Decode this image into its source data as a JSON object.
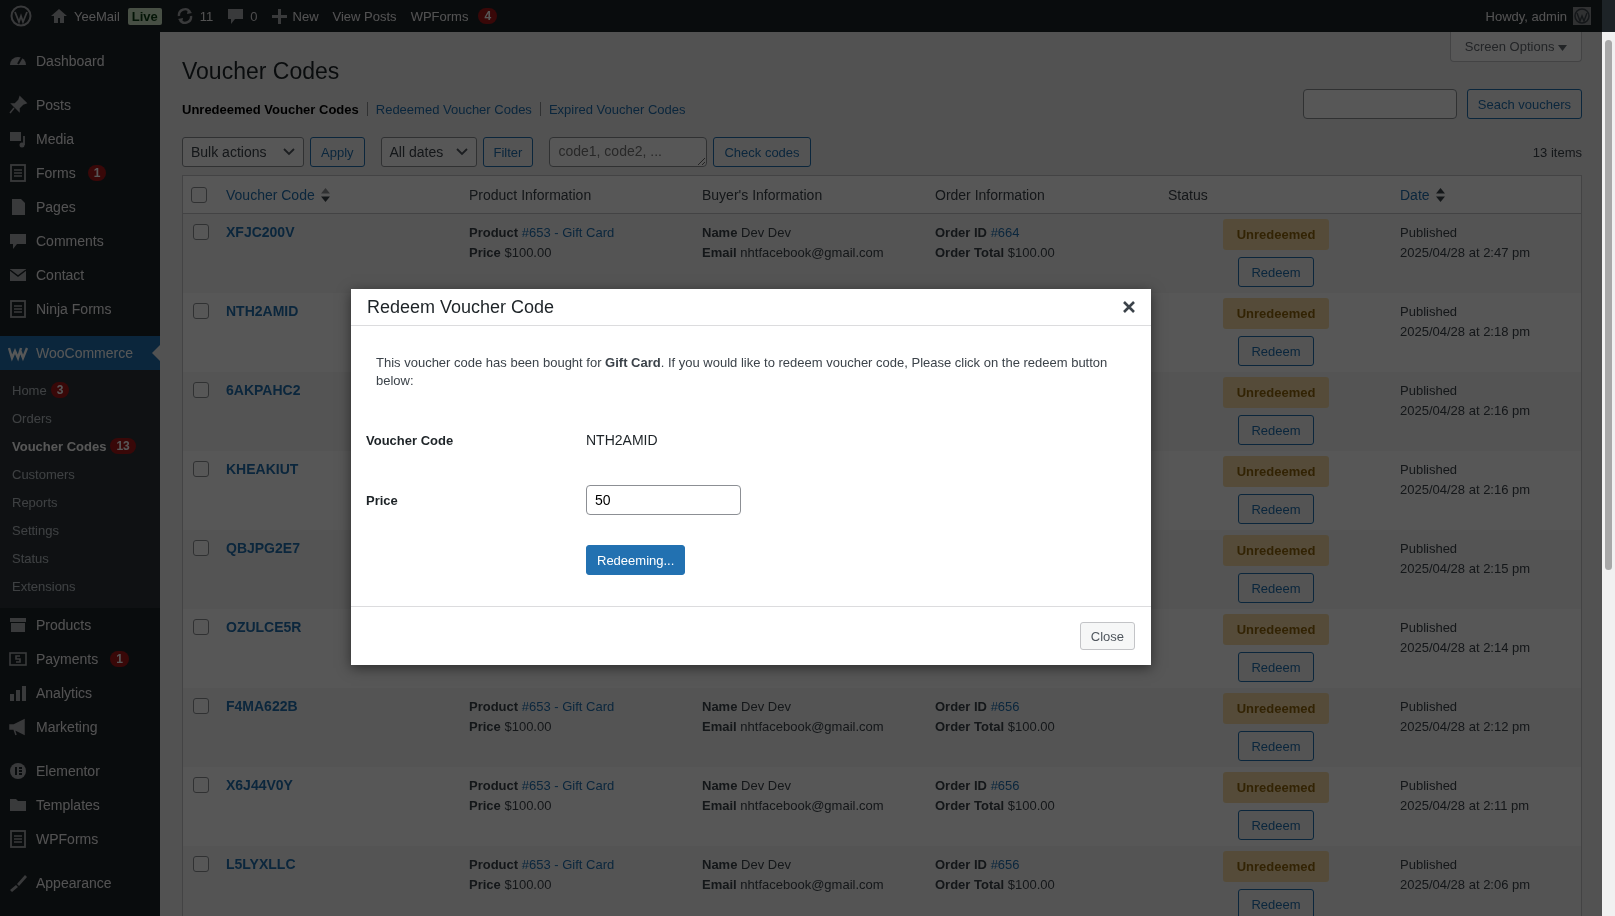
{
  "admin_bar": {
    "items": [
      {
        "kind": "logo"
      },
      {
        "kind": "site",
        "label": "YeeMail",
        "badge": "Live"
      },
      {
        "kind": "updates",
        "label": "11"
      },
      {
        "kind": "comments",
        "label": "0"
      },
      {
        "kind": "new",
        "label": "New"
      },
      {
        "kind": "link",
        "label": "View Posts"
      },
      {
        "kind": "link",
        "label": "WPForms",
        "count": "4"
      }
    ],
    "greeting": "Howdy, admin"
  },
  "sidebar": {
    "groups": [
      [
        {
          "label": "Dashboard",
          "selected": false
        }
      ],
      [
        {
          "label": "Posts",
          "selected": false
        },
        {
          "label": "Media",
          "selected": false
        },
        {
          "label": "Forms",
          "badge": "1",
          "selected": false
        },
        {
          "label": "Pages",
          "selected": false
        },
        {
          "label": "Comments",
          "selected": false
        },
        {
          "label": "Contact",
          "selected": false
        },
        {
          "label": "Ninja Forms",
          "selected": false
        }
      ],
      [
        {
          "label": "WooCommerce",
          "selected": true,
          "children": [
            {
              "label": "Home",
              "badge": "3",
              "selected": false
            },
            {
              "label": "Orders",
              "selected": false
            },
            {
              "label": "Voucher Codes",
              "badge": "13",
              "selected": true
            },
            {
              "label": "Customers",
              "selected": false
            },
            {
              "label": "Reports",
              "selected": false
            },
            {
              "label": "Settings",
              "selected": false
            },
            {
              "label": "Status",
              "selected": false
            },
            {
              "label": "Extensions",
              "selected": false
            }
          ]
        },
        {
          "label": "Products",
          "selected": false
        },
        {
          "label": "Payments",
          "badge": "1",
          "selected": false
        },
        {
          "label": "Analytics",
          "selected": false
        },
        {
          "label": "Marketing",
          "selected": false
        }
      ],
      [
        {
          "label": "Elementor",
          "selected": false
        },
        {
          "label": "Templates",
          "selected": false
        },
        {
          "label": "WPForms",
          "selected": false
        }
      ],
      [
        {
          "label": "Appearance",
          "selected": false
        }
      ]
    ]
  },
  "screen_options": "Screen Options",
  "page_title": "Voucher Codes",
  "views": [
    {
      "label": "Unredeemed Voucher Codes",
      "selected": true
    },
    {
      "label": "Redeemed Voucher Codes",
      "selected": false
    },
    {
      "label": "Expired Voucher Codes",
      "selected": false
    }
  ],
  "search": {
    "button": "Seach vouchers"
  },
  "toolbar": {
    "bulk_actions": "Bulk actions",
    "apply": "Apply",
    "dates": "All dates",
    "filter": "Filter",
    "codes_placeholder": "code1, code2, ...",
    "check_codes": "Check codes",
    "count": "13 items"
  },
  "table": {
    "select_all_checked": false,
    "columns": [
      {
        "label": "Voucher Code",
        "sortable": true
      },
      {
        "label": "Product Information",
        "sortable": false
      },
      {
        "label": "Buyer's Information",
        "sortable": false
      },
      {
        "label": "Order Information",
        "sortable": false
      },
      {
        "label": "Status",
        "sortable": false
      },
      {
        "label": "Date",
        "sortable": true
      }
    ],
    "rows": [
      {
        "code": "XFJC200V",
        "checked": false,
        "product": {
          "product_label": "Product",
          "product_link": "#653 - Gift Card",
          "price_label": "Price",
          "price": "$100.00"
        },
        "buyer": {
          "name_label": "Name",
          "name": "Dev Dev",
          "email_label": "Email",
          "email": "nhtfacebook@gmail.com"
        },
        "order": {
          "id_label": "Order ID",
          "id": "#664",
          "total_label": "Order Total",
          "total": "$100.00"
        },
        "status": "Unredeemed",
        "action": "Redeem",
        "date_status": "Published",
        "date": "2025/04/28 at 2:47 pm"
      },
      {
        "code": "NTH2AMID",
        "checked": false,
        "status": "Unredeemed",
        "action": "Redeem",
        "date_status": "Published",
        "date": "2025/04/28 at 2:18 pm"
      },
      {
        "code": "6AKPAHC2",
        "checked": false,
        "status": "Unredeemed",
        "action": "Redeem",
        "date_status": "Published",
        "date": "2025/04/28 at 2:16 pm"
      },
      {
        "code": "KHEAKIUT",
        "checked": false,
        "status": "Unredeemed",
        "action": "Redeem",
        "date_status": "Published",
        "date": "2025/04/28 at 2:16 pm"
      },
      {
        "code": "QBJPG2E7",
        "checked": false,
        "status": "Unredeemed",
        "action": "Redeem",
        "date_status": "Published",
        "date": "2025/04/28 at 2:15 pm"
      },
      {
        "code": "OZULCE5R",
        "checked": false,
        "status": "Unredeemed",
        "action": "Redeem",
        "date_status": "Published",
        "date": "2025/04/28 at 2:14 pm"
      },
      {
        "code": "F4MA622B",
        "checked": false,
        "product": {
          "product_label": "Product",
          "product_link": "#653 - Gift Card",
          "price_label": "Price",
          "price": "$100.00"
        },
        "buyer": {
          "name_label": "Name",
          "name": "Dev Dev",
          "email_label": "Email",
          "email": "nhtfacebook@gmail.com"
        },
        "order": {
          "id_label": "Order ID",
          "id": "#656",
          "total_label": "Order Total",
          "total": "$100.00"
        },
        "status": "Unredeemed",
        "action": "Redeem",
        "date_status": "Published",
        "date": "2025/04/28 at 2:12 pm"
      },
      {
        "code": "X6J44V0Y",
        "checked": false,
        "product": {
          "product_label": "Product",
          "product_link": "#653 - Gift Card",
          "price_label": "Price",
          "price": "$100.00"
        },
        "buyer": {
          "name_label": "Name",
          "name": "Dev Dev",
          "email_label": "Email",
          "email": "nhtfacebook@gmail.com"
        },
        "order": {
          "id_label": "Order ID",
          "id": "#656",
          "total_label": "Order Total",
          "total": "$100.00"
        },
        "status": "Unredeemed",
        "action": "Redeem",
        "date_status": "Published",
        "date": "2025/04/28 at 2:11 pm"
      },
      {
        "code": "L5LYXLLC",
        "checked": false,
        "product": {
          "product_label": "Product",
          "product_link": "#653 - Gift Card",
          "price_label": "Price",
          "price": "$100.00"
        },
        "buyer": {
          "name_label": "Name",
          "name": "Dev Dev",
          "email_label": "Email",
          "email": "nhtfacebook@gmail.com"
        },
        "order": {
          "id_label": "Order ID",
          "id": "#656",
          "total_label": "Order Total",
          "total": "$100.00"
        },
        "status": "Unredeemed",
        "action": "Redeem",
        "date_status": "Published",
        "date": "2025/04/28 at 2:06 pm"
      }
    ]
  },
  "modal": {
    "title": "Redeem Voucher Code",
    "message": "This voucher code has been bought for **Gift Card**. If you would like to redeem voucher code, Please click on the redeem button below:",
    "fields": [
      {
        "kind": "text",
        "label": "Voucher Code",
        "value": "NTH2AMID"
      },
      {
        "kind": "input",
        "label": "Price",
        "value": "50"
      }
    ],
    "submit": "Redeeming...",
    "close": "Close"
  }
}
